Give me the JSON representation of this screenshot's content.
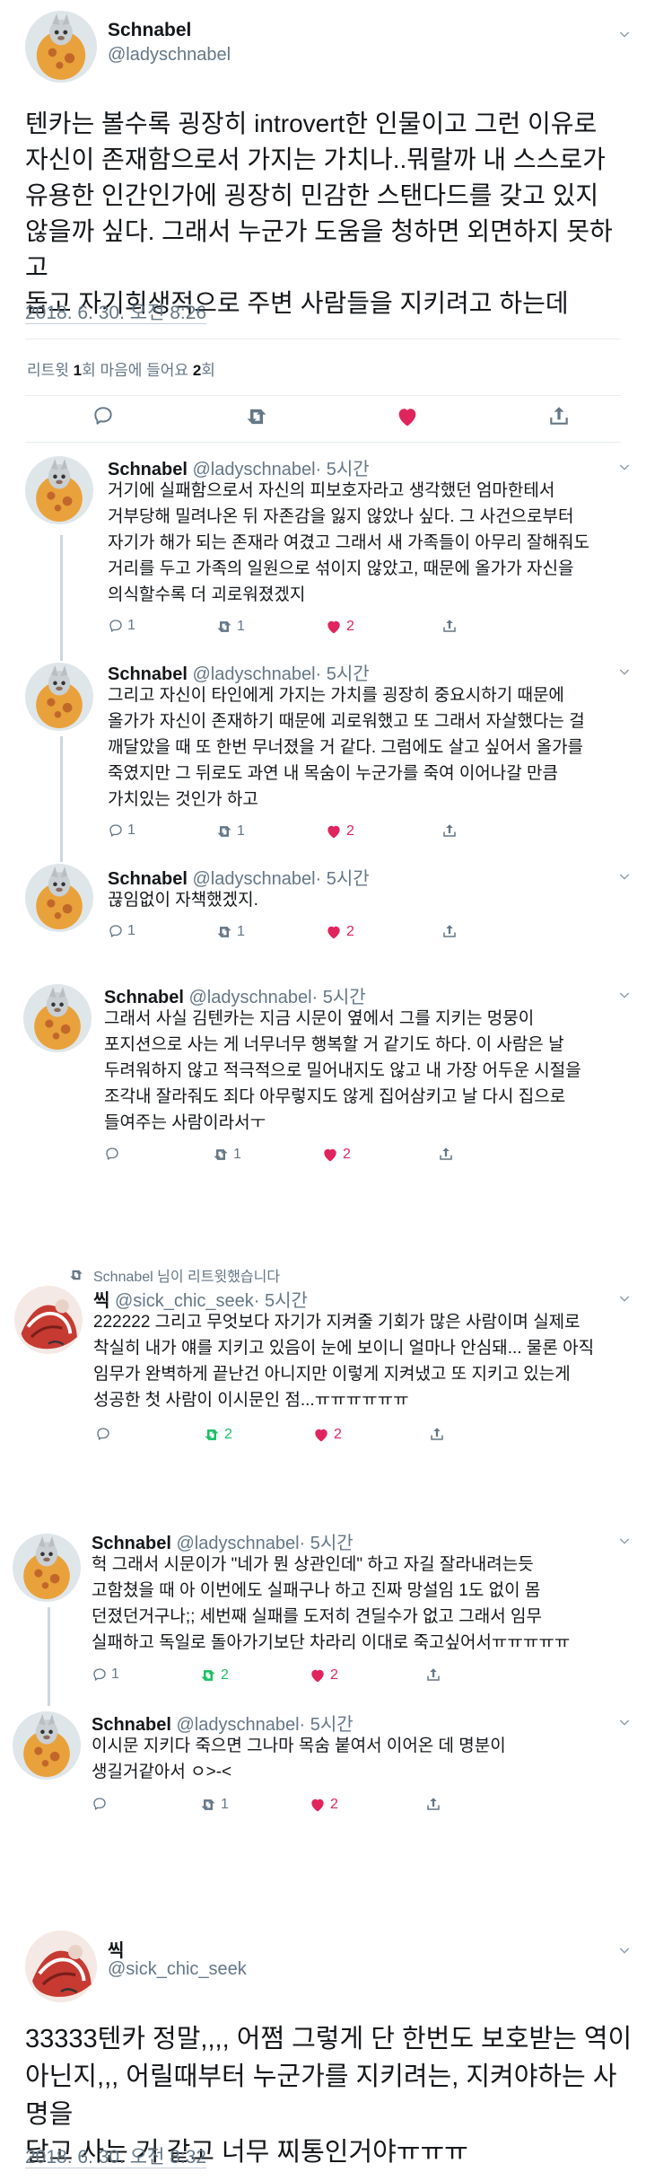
{
  "main_tweet": {
    "author_name": "Schnabel",
    "author_handle": "@ladyschnabel",
    "lines": [
      "텐카는 볼수록 굉장히 introvert한 인물이고 그런 이유로",
      "자신이 존재함으로서 가지는 가치나..뭐랄까 내 스스로가",
      "유용한 인간인가에 굉장히 민감한 스탠다드를 갖고 있지",
      "않을까 싶다. 그래서 누군가 도움을 청하면 외면하지 못하고",
      "돕고 자기희생적으로 주변 사람들을 지키려고 하는데"
    ],
    "timestamp": "2018. 6. 30. 오전 8:26",
    "stats": {
      "retweet_label": "리트윗",
      "retweet_count": "1",
      "retweet_unit": "회",
      "like_label": "마음에 들어요",
      "like_count": "2",
      "like_unit": "회"
    }
  },
  "replies": [
    {
      "author_name": "Schnabel",
      "author_handle": "@ladyschnabel",
      "time": "· 5시간",
      "lines": [
        "거기에 실패함으로서 자신의 피보호자라고 생각했던 엄마한테서",
        "거부당해 밀려나온 뒤 자존감을 잃지 않았나 싶다. 그 사건으로부터",
        "자기가 해가 되는 존재라 여겼고 그래서 새 가족들이 아무리 잘해줘도",
        "거리를 두고 가족의 일원으로 섞이지 않았고, 때문에 올가가 자신을",
        "의식할수록 더 괴로워졌겠지"
      ],
      "reply_count": "1",
      "retweet_count": "1",
      "like_count": "2"
    },
    {
      "author_name": "Schnabel",
      "author_handle": "@ladyschnabel",
      "time": "· 5시간",
      "lines": [
        "그리고 자신이 타인에게 가지는 가치를 굉장히 중요시하기 때문에",
        "올가가 자신이 존재하기 때문에 괴로워했고 또 그래서 자살했다는 걸",
        "깨달았을 때 또 한번 무너졌을 거 같다. 그럼에도 살고 싶어서 올가를",
        "죽였지만 그 뒤로도 과연 내 목숨이 누군가를 죽여 이어나갈 만큼",
        "가치있는 것인가 하고"
      ],
      "reply_count": "1",
      "retweet_count": "1",
      "like_count": "2"
    },
    {
      "author_name": "Schnabel",
      "author_handle": "@ladyschnabel",
      "time": "· 5시간",
      "lines": [
        "끊임없이 자책했겠지."
      ],
      "reply_count": "1",
      "retweet_count": "1",
      "like_count": "2"
    },
    {
      "author_name": "Schnabel",
      "author_handle": "@ladyschnabel",
      "time": "· 5시간",
      "lines": [
        "그래서 사실 김텐카는 지금 시문이 옆에서 그를 지키는 멍뭉이",
        "포지션으로 사는 게 너무너무 행복할 거 같기도 하다. 이 사람은 날",
        "두려워하지 않고 적극적으로 밀어내지도 않고 내 가장 어두운 시절을",
        "조각내 잘라줘도 죄다 아무렇지도 않게 집어삼키고 날 다시 집으로",
        "들여주는 사람이라서ㅜ"
      ],
      "reply_count": "",
      "retweet_count": "1",
      "like_count": "2"
    }
  ],
  "retweet_notice": "Schnabel 님이 리트윗했습니다",
  "retweeted": {
    "author_name": "씩",
    "author_handle": "@sick_chic_seek",
    "time": "· 5시간",
    "lines": [
      "222222 그리고 무엇보다 자기가 지켜줄 기회가 많은 사람이며 실제로",
      "착실히 내가 얘를 지키고 있음이 눈에 보이니 얼마나 안심돼... 물론 아직",
      "임무가 완벽하게 끝난건 아니지만 이렇게 지켜냈고 또 지키고 있는게",
      "성공한 첫 사람이 이시문인 점...ㅠㅠㅠㅠㅠㅠ"
    ],
    "reply_count": "",
    "retweet_count": "2",
    "like_count": "2"
  },
  "later_replies": [
    {
      "author_name": "Schnabel",
      "author_handle": "@ladyschnabel",
      "time": "· 5시간",
      "lines": [
        "헉 그래서 시문이가 \"네가 뭔 상관인데\" 하고 자길 잘라내려는듯",
        "고함쳤을 때 아 이번에도 실패구나 하고 진짜 망설임 1도 없이 몸",
        "던졌던거구나;; 세번째 실패를 도저히 견딜수가 없고 그래서 임무",
        "실패하고 독일로 돌아가기보단 차라리 이대로 죽고싶어서ㅠㅠㅠㅠㅠ"
      ],
      "reply_count": "1",
      "retweet_count": "2",
      "like_count": "2"
    },
    {
      "author_name": "Schnabel",
      "author_handle": "@ladyschnabel",
      "time": "· 5시간",
      "lines": [
        "이시문 지키다 죽으면 그나마 목숨 붙여서 이어온 데 명분이",
        "생길거같아서 ㅇ>-<"
      ],
      "reply_count": "",
      "retweet_count": "1",
      "like_count": "2"
    }
  ],
  "final_tweet": {
    "author_name": "씩",
    "author_handle": "@sick_chic_seek",
    "lines": [
      "33333텐카 정말,,,, 어쩜 그렇게 단 한번도 보호받는 역이",
      "아닌지,,, 어릴때부터 누군가를 지키려는, 지켜야하는 사명을",
      "달고 사는 거 같고 너무 찌통인거야ㅠㅠㅠ"
    ],
    "timestamp": "2018. 6. 30. 오전 8:32"
  },
  "colors": {
    "text": "#14171a",
    "secondary": "#657786",
    "like_red": "#e0245e",
    "retweet_green": "#17bf63",
    "divider": "#e6ecf0"
  }
}
